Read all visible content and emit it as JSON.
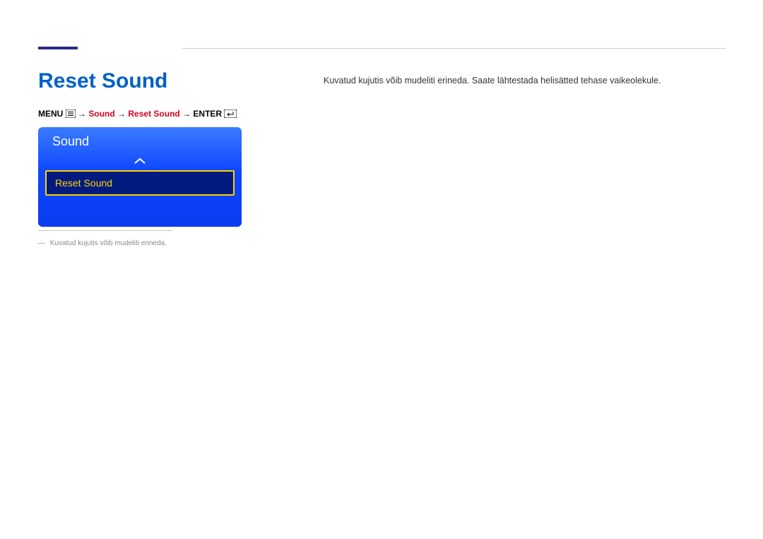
{
  "heading": "Reset Sound",
  "breadcrumb": {
    "menu": "MENU",
    "sound": "Sound",
    "reset_sound": "Reset Sound",
    "enter": "ENTER",
    "arrow": "→"
  },
  "menu_card": {
    "title": "Sound",
    "item": "Reset Sound"
  },
  "footnote": "Kuvatud kujutis võib mudeliti erineda.",
  "body": "Kuvatud kujutis võib mudeliti erineda. Saate lähtestada helisätted tehase vaikeolekule."
}
